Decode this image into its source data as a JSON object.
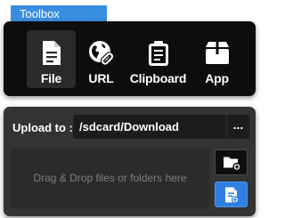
{
  "panel_title": "Toolbox",
  "sources": [
    {
      "label": "File",
      "icon": "file-icon",
      "active": true
    },
    {
      "label": "URL",
      "icon": "globe-link-icon",
      "active": false
    },
    {
      "label": "Clipboard",
      "icon": "clipboard-icon",
      "active": false
    },
    {
      "label": "App",
      "icon": "app-box-icon",
      "active": false
    }
  ],
  "upload": {
    "label": "Upload to :",
    "path": "/sdcard/Download",
    "more_label": "...",
    "drop_hint": "Drag & Drop files or folders here",
    "add_folder_icon": "folder-add-icon",
    "add_file_icon": "file-add-icon"
  },
  "colors": {
    "accent": "#3a8ee2",
    "panel_dark": "#0d0d0d",
    "panel_mid": "#333333"
  }
}
